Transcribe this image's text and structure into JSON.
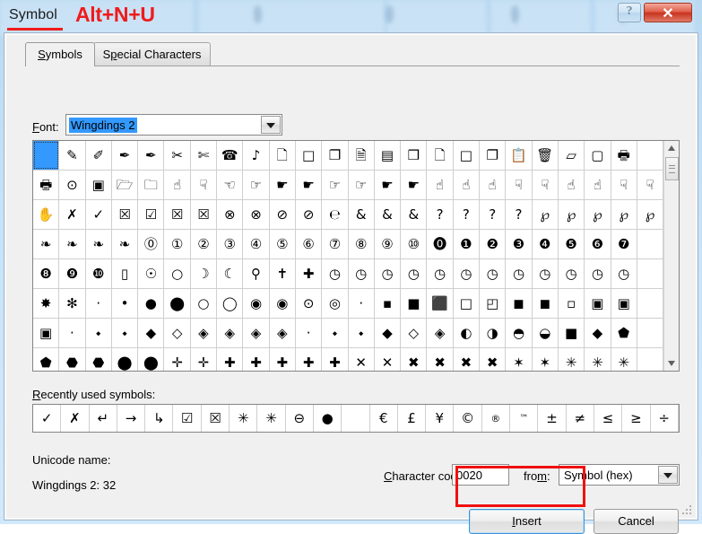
{
  "window": {
    "title": "Symbol",
    "shortcut_hint": "Alt+N+U",
    "help_icon": "?",
    "close_icon": "✕",
    "accent_red": "#f01c1c",
    "selection_blue": "#3399ff"
  },
  "tabs": [
    {
      "label": "Symbols",
      "active": true
    },
    {
      "label": "Special Characters",
      "active": false
    }
  ],
  "font_row": {
    "label": "Font:",
    "value": "Wingdings 2",
    "dropdown_icon": "chevron-down-icon"
  },
  "grid": {
    "selected_index": 0,
    "rows": [
      [
        "",
        "✎",
        "✐",
        "✑",
        "✒",
        "✂",
        "✄",
        "☎"
      ],
      [
        "🖷",
        "⊙",
        "🖸",
        "🗁",
        "🗀",
        "👍",
        "👎",
        "☜"
      ],
      [
        "✋",
        "✗",
        "✓",
        "☒",
        "☑",
        "☒",
        "☒",
        "⊗"
      ],
      [
        "❧",
        "❧",
        "❧",
        "❧",
        "⓪",
        "①",
        "②",
        "③"
      ],
      [
        "⑧",
        "⑨",
        "⑩",
        "▯",
        "☼",
        "○",
        "☽",
        "☾"
      ],
      [
        "✥",
        "✥",
        "·",
        "•",
        "●",
        "⬤",
        "○",
        "◯"
      ],
      [
        "▣",
        "·",
        "✦",
        "✦",
        "◆",
        "◇",
        "◈",
        "◈"
      ],
      [
        "⬟",
        "⬟",
        "⬟",
        "⬟",
        "⬟",
        "✚",
        "✚",
        "✚"
      ]
    ],
    "rows_right": [
      [
        "♪",
        "🗋",
        "□",
        "🗐",
        "🗎",
        "🗏",
        "🗐",
        "🗋",
        "🗋",
        "▭",
        "🗐",
        "📋",
        "🗑",
        "🗃",
        "▢",
        "🖶"
      ],
      [
        "☞",
        "☛",
        "☛",
        "☞",
        "☞",
        "☛",
        "☛",
        "☝",
        "☝",
        "☝",
        "☟",
        "☟",
        "☝",
        "☝",
        "☟",
        "☟"
      ],
      [
        "⊘",
        "⊘",
        "⊘",
        "℮",
        "&",
        "&",
        "&",
        "?",
        "?",
        "?",
        "?",
        "℘",
        "℘",
        "℘",
        "℘",
        "℘"
      ],
      [
        "④",
        "⑤",
        "⑥",
        "⑦",
        "⑧",
        "⑨",
        "⑩",
        "❶",
        "❶",
        "❷",
        "❸",
        "❹",
        "❺",
        "❻",
        "❼",
        "❼"
      ]
    ],
    "scrollbar": {
      "up_icon": "scroll-up-arrow",
      "down_icon": "scroll-down-arrow",
      "thumb_position_pct": 7
    }
  },
  "recent": {
    "label": "Recently used symbols:",
    "symbols": [
      "✓",
      "✗",
      "↵",
      "→",
      "↳",
      "☑",
      "☒",
      "✳",
      "✳",
      "⊖",
      "●",
      "",
      "€",
      "£",
      "¥",
      "©",
      "®",
      "™",
      "±",
      "≠",
      "≤",
      "≥",
      "÷"
    ]
  },
  "unicode": {
    "label": "Unicode name:",
    "value": "Wingdings 2: 32"
  },
  "charcode": {
    "label": "Character code:",
    "value": "0020"
  },
  "from": {
    "label": "from:",
    "value": "Symbol (hex)",
    "dropdown_icon": "chevron-down-icon"
  },
  "footer": {
    "insert_label": "Insert",
    "cancel_label": "Cancel"
  }
}
